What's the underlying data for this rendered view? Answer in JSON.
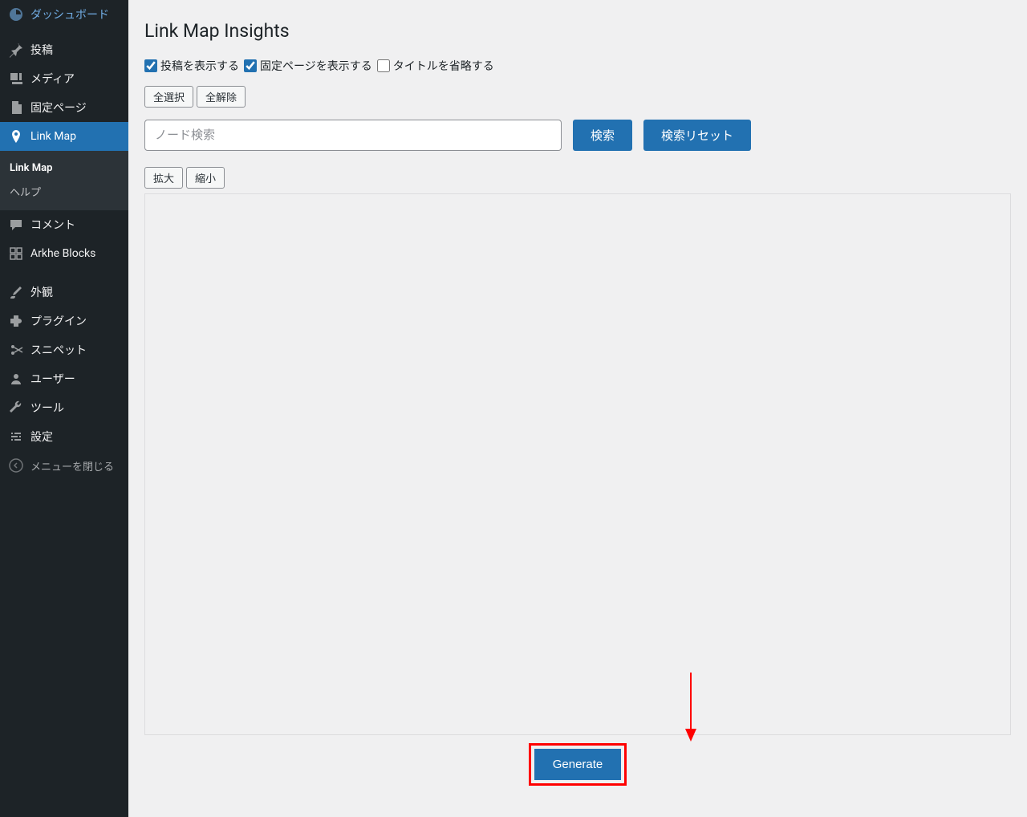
{
  "sidebar": {
    "items": [
      {
        "label": "ダッシュボード",
        "icon": "dashboard"
      },
      {
        "label": "投稿",
        "icon": "pushpin"
      },
      {
        "label": "メディア",
        "icon": "media"
      },
      {
        "label": "固定ページ",
        "icon": "page"
      },
      {
        "label": "Link Map",
        "icon": "location"
      },
      {
        "label": "コメント",
        "icon": "comment"
      },
      {
        "label": "Arkhe Blocks",
        "icon": "arkhe"
      },
      {
        "label": "外観",
        "icon": "brush"
      },
      {
        "label": "プラグイン",
        "icon": "plugin"
      },
      {
        "label": "スニペット",
        "icon": "scissors"
      },
      {
        "label": "ユーザー",
        "icon": "user"
      },
      {
        "label": "ツール",
        "icon": "wrench"
      },
      {
        "label": "設定",
        "icon": "settings"
      }
    ],
    "submenu": [
      {
        "label": "Link Map"
      },
      {
        "label": "ヘルプ"
      }
    ],
    "collapse_label": "メニューを閉じる"
  },
  "main": {
    "title": "Link Map Insights",
    "checkboxes": {
      "show_posts": "投稿を表示する",
      "show_pages": "固定ページを表示する",
      "abbreviate_titles": "タイトルを省略する"
    },
    "buttons": {
      "select_all": "全選択",
      "deselect_all": "全解除",
      "search": "検索",
      "reset_search": "検索リセット",
      "zoom_in": "拡大",
      "zoom_out": "縮小",
      "generate": "Generate"
    },
    "search_placeholder": "ノード検索"
  }
}
